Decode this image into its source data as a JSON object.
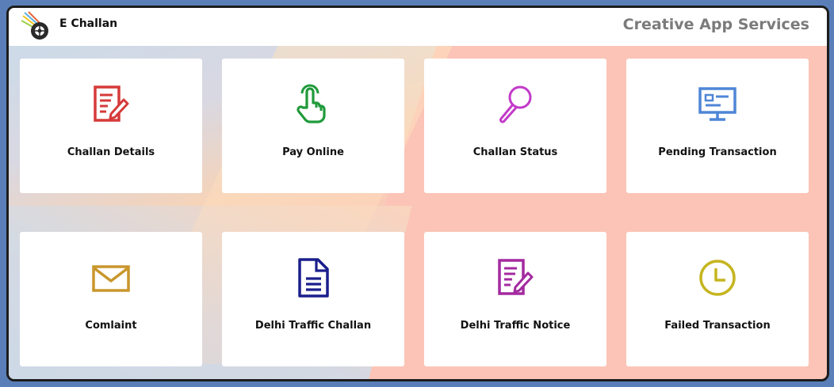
{
  "header": {
    "app_title": "E Challan",
    "brand": "Creative App Services",
    "logo_icon": "wheel-logo-icon"
  },
  "tiles": [
    {
      "label": "Challan Details",
      "icon": "document-edit-icon",
      "color": "#d63a3a"
    },
    {
      "label": "Pay Online",
      "icon": "hand-pointer-icon",
      "color": "#1f9a3a"
    },
    {
      "label": "Challan Status",
      "icon": "magnifier-icon",
      "color": "#c33ac9"
    },
    {
      "label": "Pending Transaction",
      "icon": "monitor-icon",
      "color": "#4f86d6"
    },
    {
      "label": "Comlaint",
      "icon": "envelope-icon",
      "color": "#c9962c"
    },
    {
      "label": "Delhi Traffic Challan",
      "icon": "document-icon",
      "color": "#1a1f8c"
    },
    {
      "label": "Delhi Traffic Notice",
      "icon": "document-edit-icon",
      "color": "#a32aa0"
    },
    {
      "label": "Failed Transaction",
      "icon": "clock-icon",
      "color": "#c5b51f"
    }
  ]
}
